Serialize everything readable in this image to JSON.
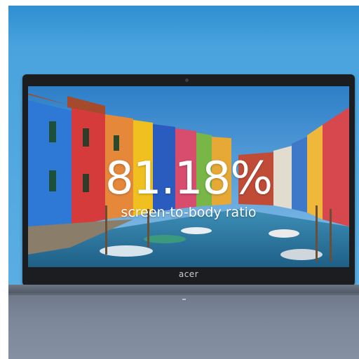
{
  "promo": {
    "headline": "81.18%",
    "subline": "screen-to-body ratio"
  },
  "laptop": {
    "brand": "acer"
  },
  "colors": {
    "sky": "#4aa3dd",
    "bezel": "#1b1d20",
    "chassis": "#7c879a",
    "text": "#ffffff"
  },
  "scene": {
    "description_icons": [
      "colorful-houses",
      "canal",
      "boats"
    ]
  }
}
